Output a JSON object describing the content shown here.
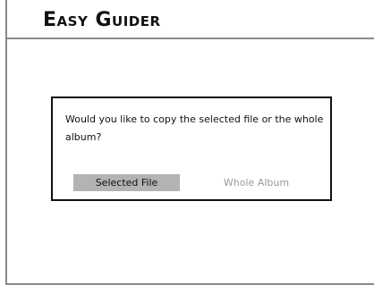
{
  "app": {
    "title": "Easy Guider"
  },
  "dialog": {
    "message": "Would you like to copy the selected file or the whole album?",
    "buttons": {
      "selected_file": "Selected File",
      "whole_album": "Whole Album"
    }
  },
  "colors": {
    "frame_line": "#8a8a8a",
    "dialog_border": "#111111",
    "highlight": "#b3b3b3",
    "inactive_text": "#9a9a9a"
  }
}
